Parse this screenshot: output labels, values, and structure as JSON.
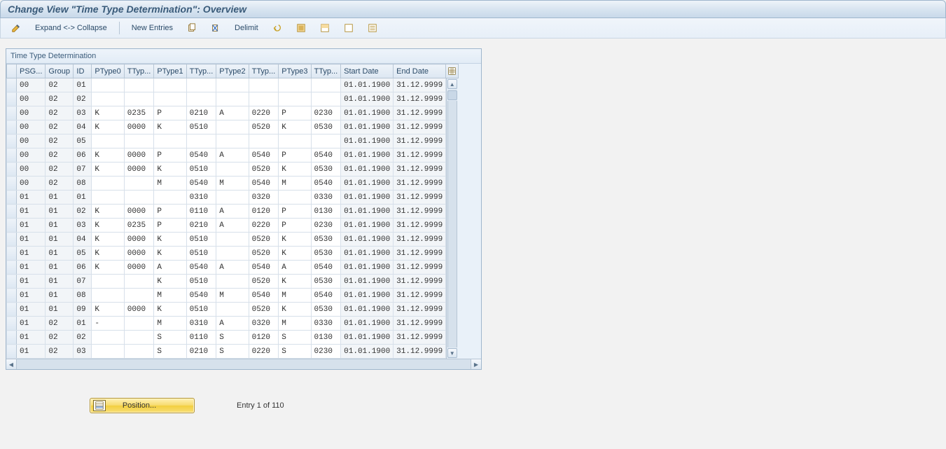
{
  "header": {
    "title": "Change View \"Time Type Determination\": Overview"
  },
  "toolbar": {
    "expand_collapse": "Expand <-> Collapse",
    "new_entries": "New Entries",
    "delimit": "Delimit"
  },
  "panel": {
    "title": "Time Type Determination"
  },
  "columns": {
    "psg": "PSG...",
    "group": "Group",
    "id": "ID",
    "ptype0": "PType0",
    "ttype0": "TTyp...",
    "ptype1": "PType1",
    "ttype1": "TTyp...",
    "ptype2": "PType2",
    "ttype2": "TTyp...",
    "ptype3": "PType3",
    "ttype3": "TTyp...",
    "start_date": "Start Date",
    "end_date": "End Date"
  },
  "rows": [
    {
      "psg": "00",
      "group": "02",
      "id": "01",
      "pt0": "",
      "tt0": "",
      "pt1": "",
      "tt1": "",
      "pt2": "",
      "tt2": "",
      "pt3": "",
      "tt3": "",
      "start": "01.01.1900",
      "end": "31.12.9999"
    },
    {
      "psg": "00",
      "group": "02",
      "id": "02",
      "pt0": "",
      "tt0": "",
      "pt1": "",
      "tt1": "",
      "pt2": "",
      "tt2": "",
      "pt3": "",
      "tt3": "",
      "start": "01.01.1900",
      "end": "31.12.9999"
    },
    {
      "psg": "00",
      "group": "02",
      "id": "03",
      "pt0": "K",
      "tt0": "0235",
      "pt1": "P",
      "tt1": "0210",
      "pt2": "A",
      "tt2": "0220",
      "pt3": "P",
      "tt3": "0230",
      "start": "01.01.1900",
      "end": "31.12.9999"
    },
    {
      "psg": "00",
      "group": "02",
      "id": "04",
      "pt0": "K",
      "tt0": "0000",
      "pt1": "K",
      "tt1": "0510",
      "pt2": "",
      "tt2": "0520",
      "pt3": "K",
      "tt3": "0530",
      "start": "01.01.1900",
      "end": "31.12.9999"
    },
    {
      "psg": "00",
      "group": "02",
      "id": "05",
      "pt0": "",
      "tt0": "",
      "pt1": "",
      "tt1": "",
      "pt2": "",
      "tt2": "",
      "pt3": "",
      "tt3": "",
      "start": "01.01.1900",
      "end": "31.12.9999"
    },
    {
      "psg": "00",
      "group": "02",
      "id": "06",
      "pt0": "K",
      "tt0": "0000",
      "pt1": "P",
      "tt1": "0540",
      "pt2": "A",
      "tt2": "0540",
      "pt3": "P",
      "tt3": "0540",
      "start": "01.01.1900",
      "end": "31.12.9999"
    },
    {
      "psg": "00",
      "group": "02",
      "id": "07",
      "pt0": "K",
      "tt0": "0000",
      "pt1": "K",
      "tt1": "0510",
      "pt2": "",
      "tt2": "0520",
      "pt3": "K",
      "tt3": "0530",
      "start": "01.01.1900",
      "end": "31.12.9999"
    },
    {
      "psg": "00",
      "group": "02",
      "id": "08",
      "pt0": "",
      "tt0": "",
      "pt1": "M",
      "tt1": "0540",
      "pt2": "M",
      "tt2": "0540",
      "pt3": "M",
      "tt3": "0540",
      "start": "01.01.1900",
      "end": "31.12.9999"
    },
    {
      "psg": "01",
      "group": "01",
      "id": "01",
      "pt0": "",
      "tt0": "",
      "pt1": "",
      "tt1": "0310",
      "pt2": "",
      "tt2": "0320",
      "pt3": "",
      "tt3": "0330",
      "start": "01.01.1900",
      "end": "31.12.9999"
    },
    {
      "psg": "01",
      "group": "01",
      "id": "02",
      "pt0": "K",
      "tt0": "0000",
      "pt1": "P",
      "tt1": "0110",
      "pt2": "A",
      "tt2": "0120",
      "pt3": "P",
      "tt3": "0130",
      "start": "01.01.1900",
      "end": "31.12.9999"
    },
    {
      "psg": "01",
      "group": "01",
      "id": "03",
      "pt0": "K",
      "tt0": "0235",
      "pt1": "P",
      "tt1": "0210",
      "pt2": "A",
      "tt2": "0220",
      "pt3": "P",
      "tt3": "0230",
      "start": "01.01.1900",
      "end": "31.12.9999"
    },
    {
      "psg": "01",
      "group": "01",
      "id": "04",
      "pt0": "K",
      "tt0": "0000",
      "pt1": "K",
      "tt1": "0510",
      "pt2": "",
      "tt2": "0520",
      "pt3": "K",
      "tt3": "0530",
      "start": "01.01.1900",
      "end": "31.12.9999"
    },
    {
      "psg": "01",
      "group": "01",
      "id": "05",
      "pt0": "K",
      "tt0": "0000",
      "pt1": "K",
      "tt1": "0510",
      "pt2": "",
      "tt2": "0520",
      "pt3": "K",
      "tt3": "0530",
      "start": "01.01.1900",
      "end": "31.12.9999"
    },
    {
      "psg": "01",
      "group": "01",
      "id": "06",
      "pt0": "K",
      "tt0": "0000",
      "pt1": "A",
      "tt1": "0540",
      "pt2": "A",
      "tt2": "0540",
      "pt3": "A",
      "tt3": "0540",
      "start": "01.01.1900",
      "end": "31.12.9999"
    },
    {
      "psg": "01",
      "group": "01",
      "id": "07",
      "pt0": "",
      "tt0": "",
      "pt1": "K",
      "tt1": "0510",
      "pt2": "",
      "tt2": "0520",
      "pt3": "K",
      "tt3": "0530",
      "start": "01.01.1900",
      "end": "31.12.9999"
    },
    {
      "psg": "01",
      "group": "01",
      "id": "08",
      "pt0": "",
      "tt0": "",
      "pt1": "M",
      "tt1": "0540",
      "pt2": "M",
      "tt2": "0540",
      "pt3": "M",
      "tt3": "0540",
      "start": "01.01.1900",
      "end": "31.12.9999"
    },
    {
      "psg": "01",
      "group": "01",
      "id": "09",
      "pt0": "K",
      "tt0": "0000",
      "pt1": "K",
      "tt1": "0510",
      "pt2": "",
      "tt2": "0520",
      "pt3": "K",
      "tt3": "0530",
      "start": "01.01.1900",
      "end": "31.12.9999"
    },
    {
      "psg": "01",
      "group": "02",
      "id": "01",
      "pt0": "-",
      "tt0": "",
      "pt1": "M",
      "tt1": "0310",
      "pt2": "A",
      "tt2": "0320",
      "pt3": "M",
      "tt3": "0330",
      "start": "01.01.1900",
      "end": "31.12.9999"
    },
    {
      "psg": "01",
      "group": "02",
      "id": "02",
      "pt0": "",
      "tt0": "",
      "pt1": "S",
      "tt1": "0110",
      "pt2": "S",
      "tt2": "0120",
      "pt3": "S",
      "tt3": "0130",
      "start": "01.01.1900",
      "end": "31.12.9999"
    },
    {
      "psg": "01",
      "group": "02",
      "id": "03",
      "pt0": "",
      "tt0": "",
      "pt1": "S",
      "tt1": "0210",
      "pt2": "S",
      "tt2": "0220",
      "pt3": "S",
      "tt3": "0230",
      "start": "01.01.1900",
      "end": "31.12.9999"
    }
  ],
  "footer": {
    "position_label": "Position...",
    "status": "Entry 1 of 110"
  }
}
